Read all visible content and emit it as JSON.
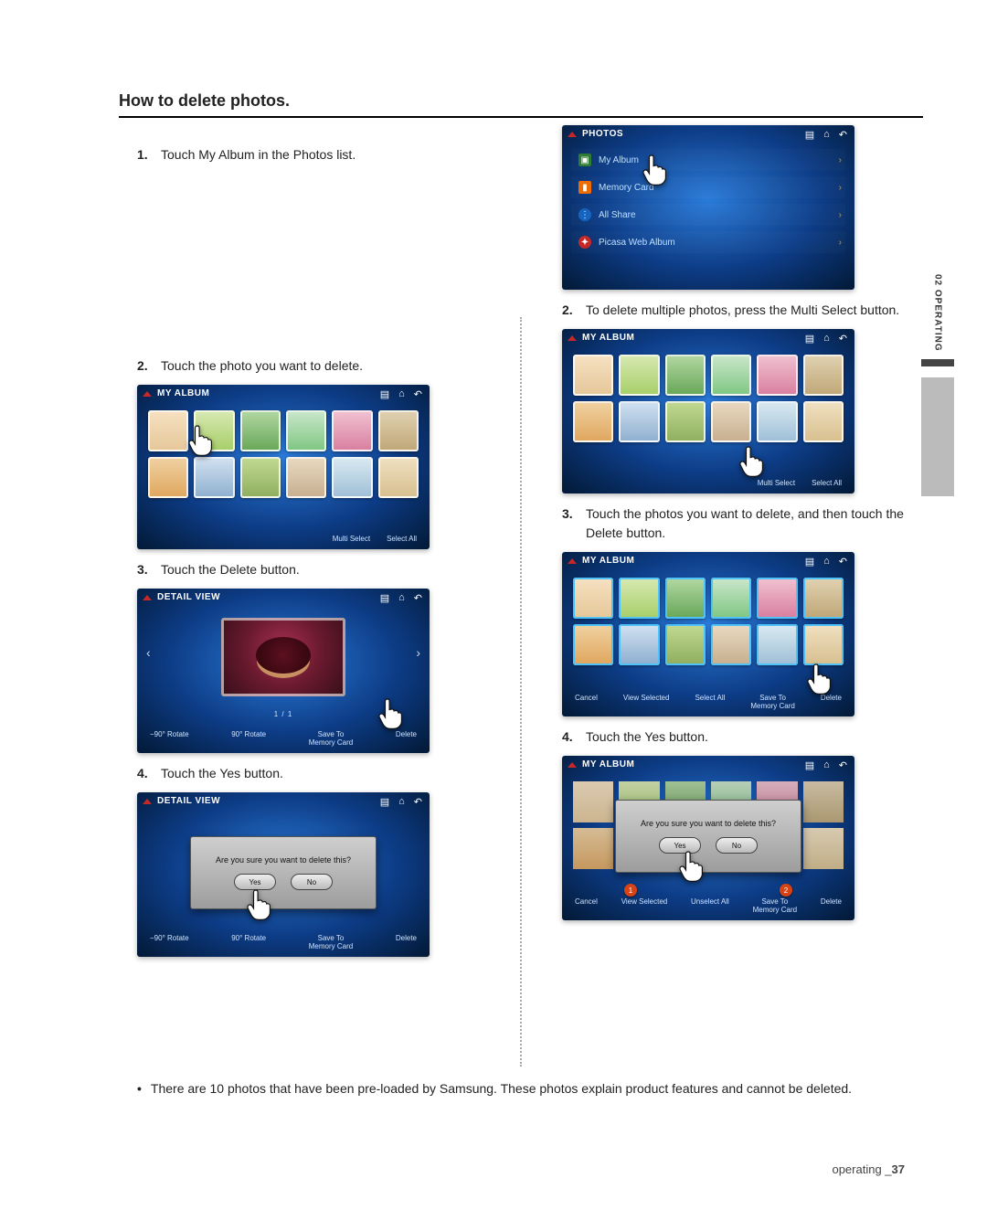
{
  "section_title": "How to delete photos.",
  "side_tab": "02 OPERATING",
  "footer": {
    "label": "operating _",
    "page": "37"
  },
  "note": "There are 10 photos that have been pre-loaded by Samsung. These photos explain product features and cannot be deleted.",
  "left": {
    "step1": {
      "num": "1.",
      "text": "Touch My Album in the Photos list."
    },
    "step2": {
      "num": "2.",
      "text": "Touch the photo you want to delete."
    },
    "step3": {
      "num": "3.",
      "text": "Touch the Delete button."
    },
    "step4": {
      "num": "4.",
      "text": "Touch the Yes button."
    }
  },
  "right": {
    "step2": {
      "num": "2.",
      "text": "To delete multiple photos, press the Multi Select button."
    },
    "step3": {
      "num": "3.",
      "text": "Touch the photos you want to delete, and then touch the Delete button."
    },
    "step4": {
      "num": "4.",
      "text": "Touch the Yes button."
    }
  },
  "screens": {
    "photos_list": {
      "title": "PHOTOS",
      "items": [
        "My Album",
        "Memory Card",
        "All Share",
        "Picasa Web Album"
      ]
    },
    "album": {
      "title": "MY ALBUM",
      "btn_multi": "Multi Select",
      "btn_selall": "Select All"
    },
    "detail": {
      "title": "DETAIL VIEW",
      "pager": "1 / 1",
      "btn_rot_ccw": "−90° Rotate",
      "btn_rot_cw": "90° Rotate",
      "btn_save": "Save To\nMemory Card",
      "btn_delete": "Delete"
    },
    "album_ms": {
      "title": "MY ALBUM",
      "btn_cancel": "Cancel",
      "btn_viewsel": "View Selected",
      "btn_selall": "Select All",
      "btn_save": "Save To\nMemory Card",
      "btn_delete": "Delete",
      "btn_unselall": "Unselect All"
    },
    "dialog": {
      "q": "Are you sure you want to delete this?",
      "yes": "Yes",
      "no": "No"
    },
    "badges": {
      "one": "1",
      "two": "2"
    }
  }
}
